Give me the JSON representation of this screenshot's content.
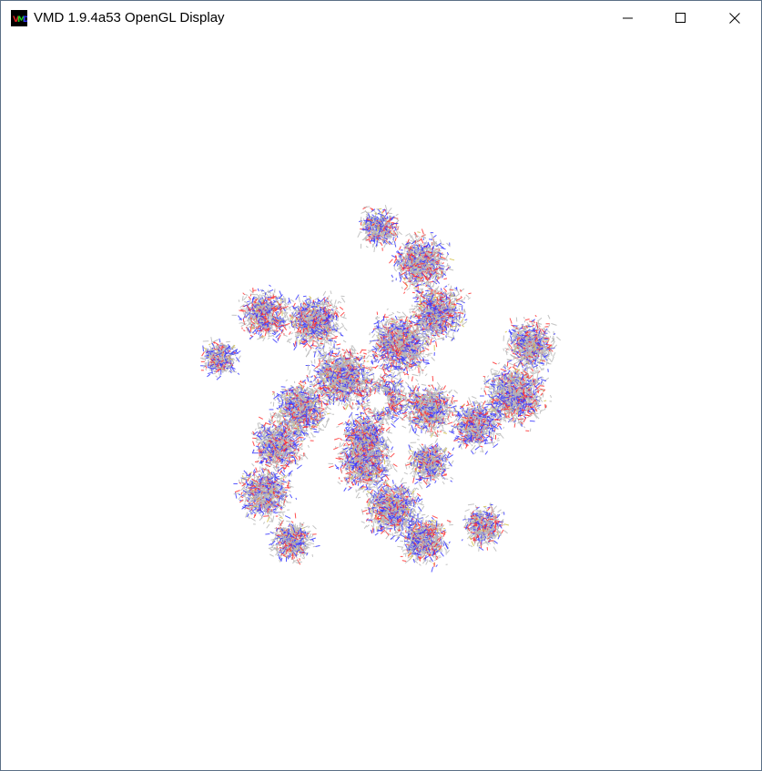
{
  "window": {
    "title": "VMD 1.9.4a53 OpenGL Display",
    "app_icon": "vmd-icon",
    "controls": {
      "minimize_icon": "minimize-icon",
      "maximize_icon": "maximize-icon",
      "close_icon": "close-icon"
    }
  },
  "display": {
    "background_color": "#ffffff",
    "representation": "lines",
    "atom_colors": {
      "carbon": "#b8b8b8",
      "nitrogen": "#3a3aff",
      "oxygen": "#ff3030",
      "sulfur": "#d4c24a"
    }
  }
}
